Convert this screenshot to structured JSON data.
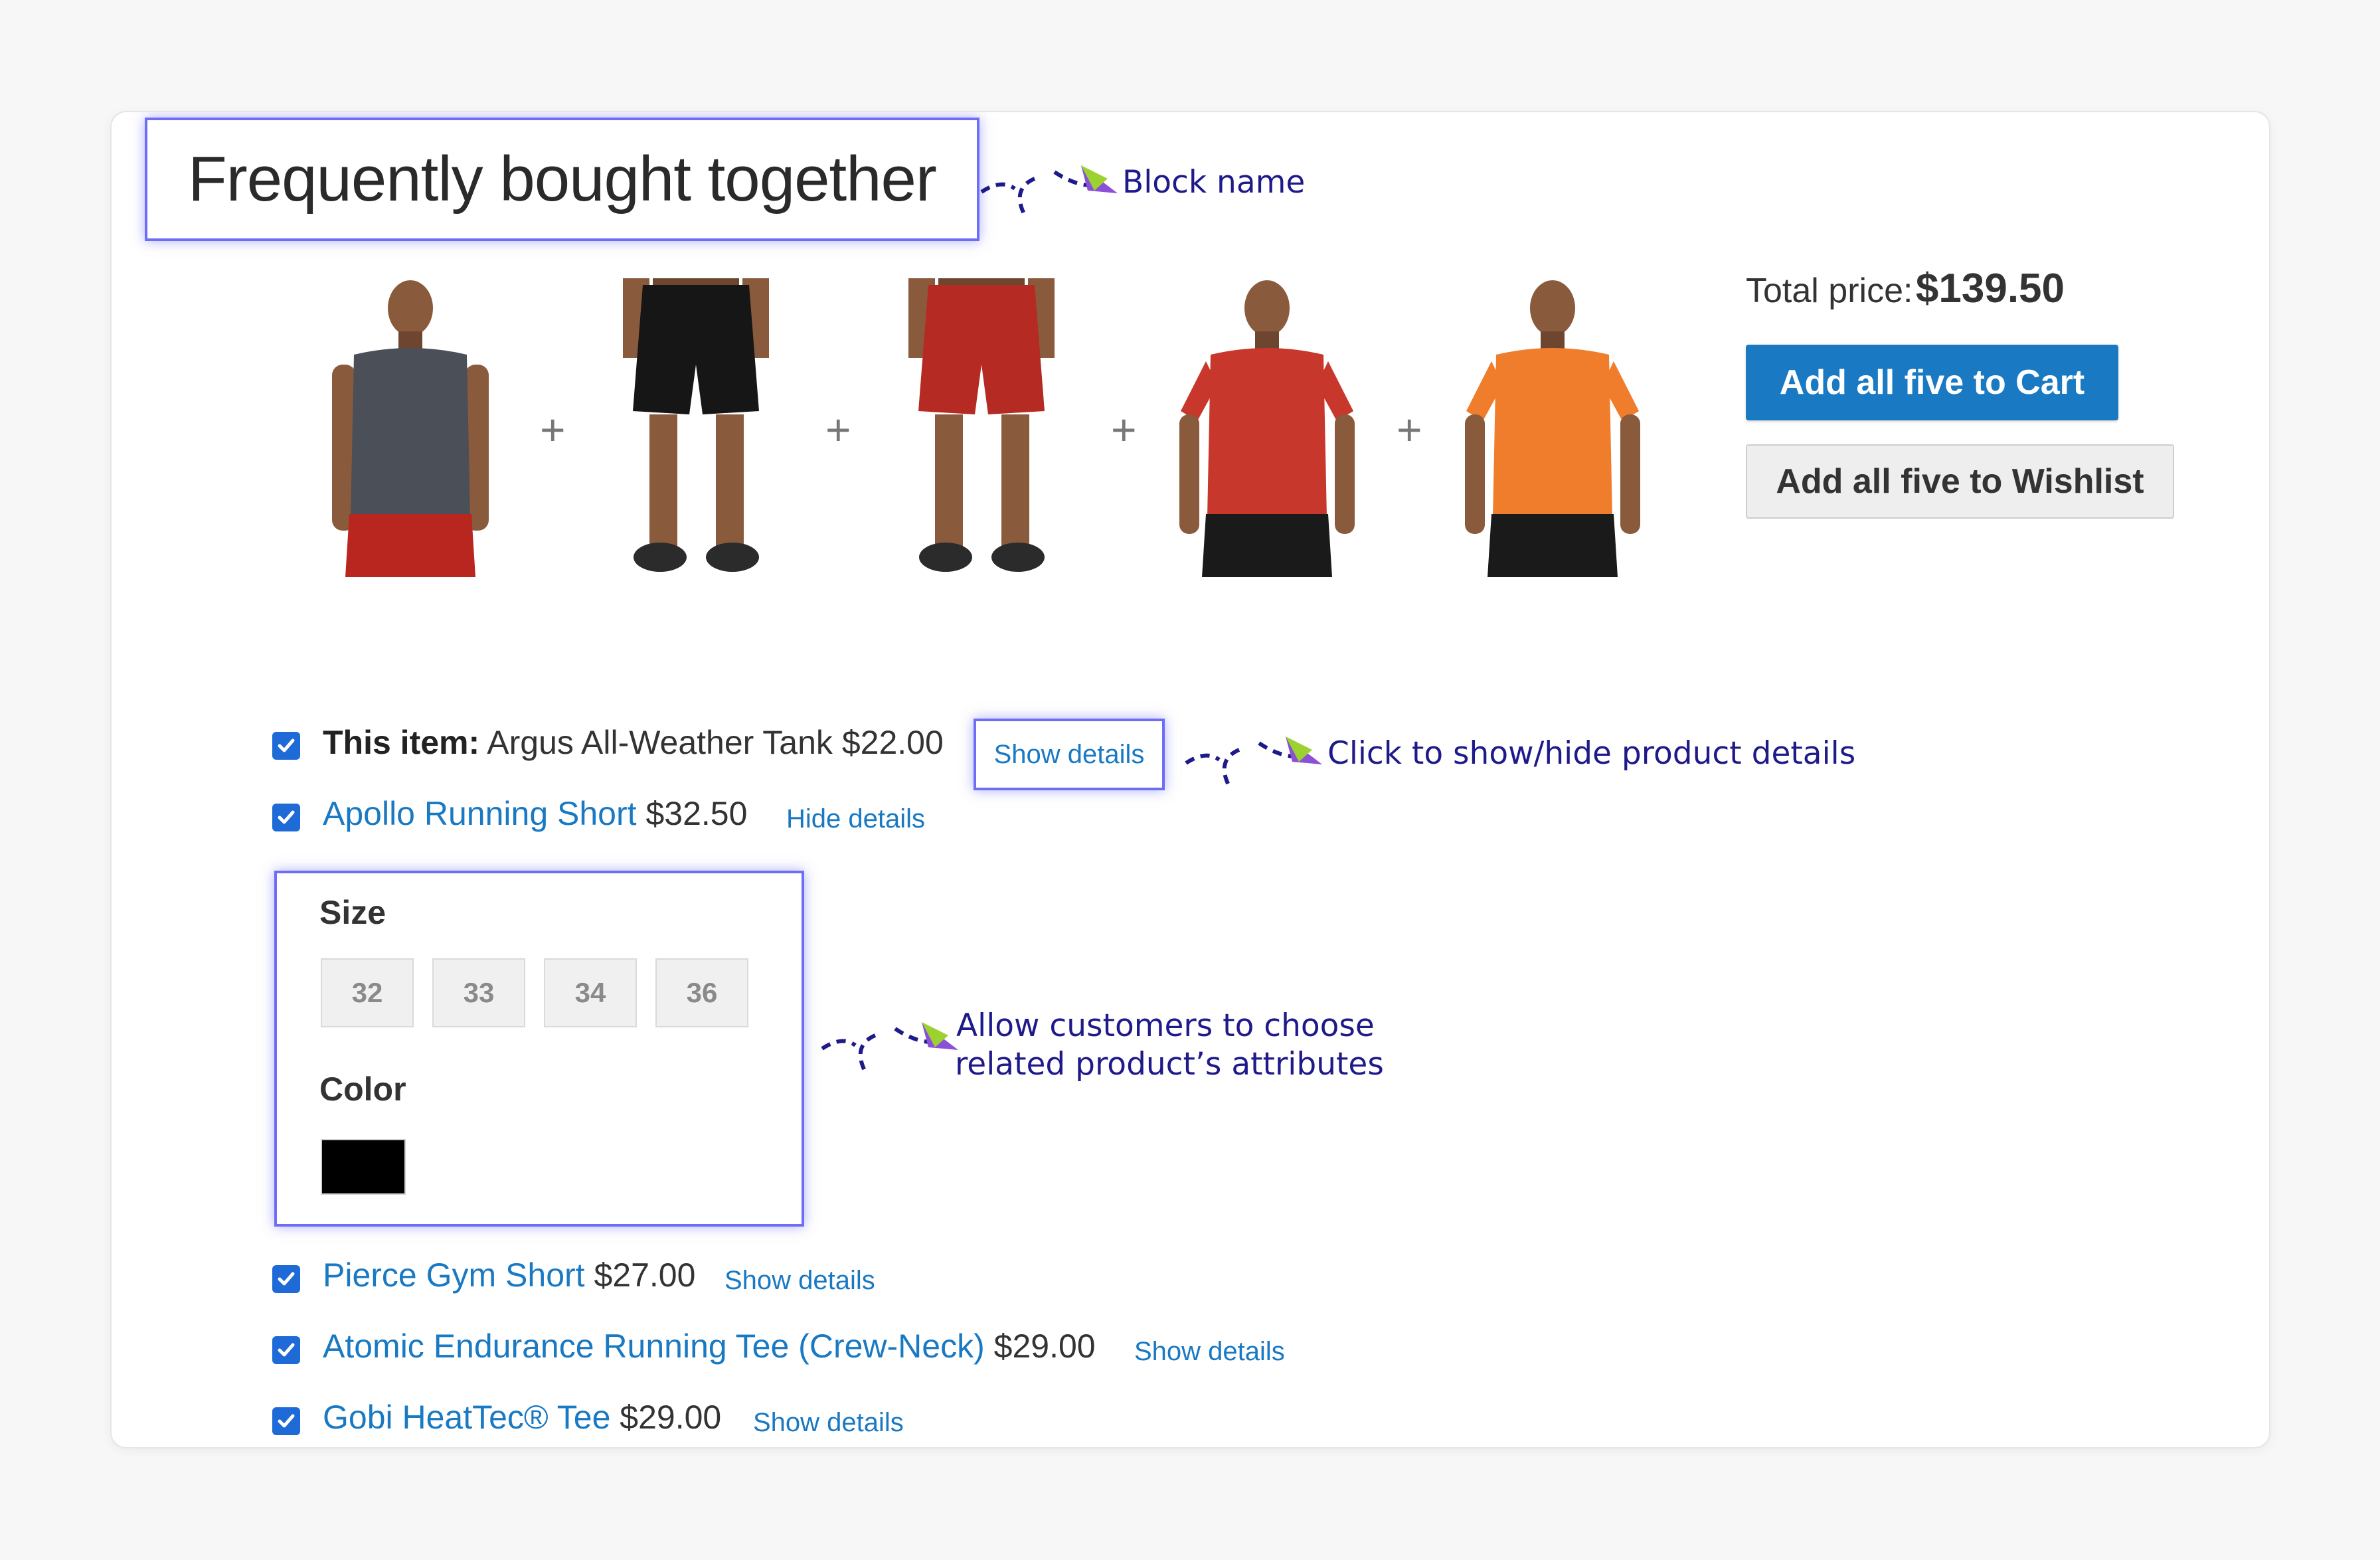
{
  "block": {
    "title": "Frequently bought together",
    "annotation_block_name": "Block name",
    "annotation_toggle": "Click to show/hide product details",
    "annotation_attributes_line1": "Allow customers to choose",
    "annotation_attributes_line2": "related product’s attributes"
  },
  "products": [
    {
      "name": "Argus All-Weather Tank",
      "shirt": "#4a4f58",
      "shorts": "#b8261f",
      "type": "tank"
    },
    {
      "name": "Apollo Running Short",
      "shirt": "none",
      "shorts": "#161616",
      "type": "shorts"
    },
    {
      "name": "Pierce Gym Short",
      "shirt": "none",
      "shorts": "#b52a22",
      "type": "shorts"
    },
    {
      "name": "Atomic Endurance Running Tee (Crew-Neck)",
      "shirt": "#c7372c",
      "shorts": "#1a1a1a",
      "type": "tee"
    },
    {
      "name": "Gobi HeatTec® Tee",
      "shirt": "#f07d2c",
      "shorts": "#1a1a1a",
      "type": "tee"
    }
  ],
  "plus_sign": "+",
  "summary": {
    "total_label": "Total price:",
    "total_value": "$139.50",
    "add_to_cart": "Add all five to Cart",
    "add_to_wishlist": "Add all five to Wishlist"
  },
  "items": [
    {
      "prefix": "This item:",
      "name": "Argus All-Weather Tank",
      "price": "$22.00",
      "toggle": "Show details",
      "checked": true
    },
    {
      "prefix": "",
      "name": "Apollo Running Short",
      "price": "$32.50",
      "toggle": "Hide details",
      "checked": true
    },
    {
      "prefix": "",
      "name": "Pierce Gym Short",
      "price": "$27.00",
      "toggle": "Show details",
      "checked": true
    },
    {
      "prefix": "",
      "name": "Atomic Endurance Running Tee (Crew-Neck)",
      "price": "$29.00",
      "toggle": "Show details",
      "checked": true
    },
    {
      "prefix": "",
      "name": "Gobi HeatTec® Tee",
      "price": "$29.00",
      "toggle": "Show details",
      "checked": true
    }
  ],
  "attributes": {
    "size_label": "Size",
    "sizes": [
      "32",
      "33",
      "34",
      "36"
    ],
    "color_label": "Color",
    "color_swatch": "#000000"
  },
  "colors": {
    "accent": "#1979c3",
    "highlight": "#6d6df6",
    "annotation_text": "#1f1a8a"
  }
}
